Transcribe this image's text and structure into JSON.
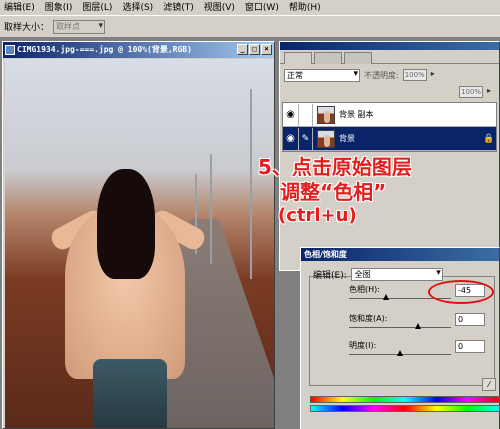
{
  "menubar": {
    "items": [
      "编辑(E)",
      "图象(I)",
      "图层(L)",
      "选择(S)",
      "滤镜(T)",
      "视图(V)",
      "窗口(W)",
      "帮助(H)"
    ]
  },
  "optionsbar": {
    "label": "取样大小：",
    "sample_value": "取样点"
  },
  "document": {
    "title": "CIMG1934.jpg-===.jpg @ 100%(背景,RGB)"
  },
  "layers_panel": {
    "blend_mode": "正常",
    "opacity_label": "不透明度:",
    "opacity_value": "100%",
    "fill_value": "100%",
    "layers": [
      {
        "name": "背景 副本",
        "selected": false
      },
      {
        "name": "背景",
        "selected": true
      }
    ]
  },
  "annotation": {
    "line1": "5、点击原始图层",
    "line2": "调整“色相”",
    "line3": "(ctrl+u)",
    "color": "#e41d1d"
  },
  "hue_dialog": {
    "title": "色相/饱和度",
    "edit_label": "编辑(E):",
    "edit_value": "全图",
    "hue_label": "色相(H):",
    "hue_value": "-45",
    "saturation_label": "饱和度(A):",
    "saturation_value": "0",
    "lightness_label": "明度(I):",
    "lightness_value": "0"
  }
}
